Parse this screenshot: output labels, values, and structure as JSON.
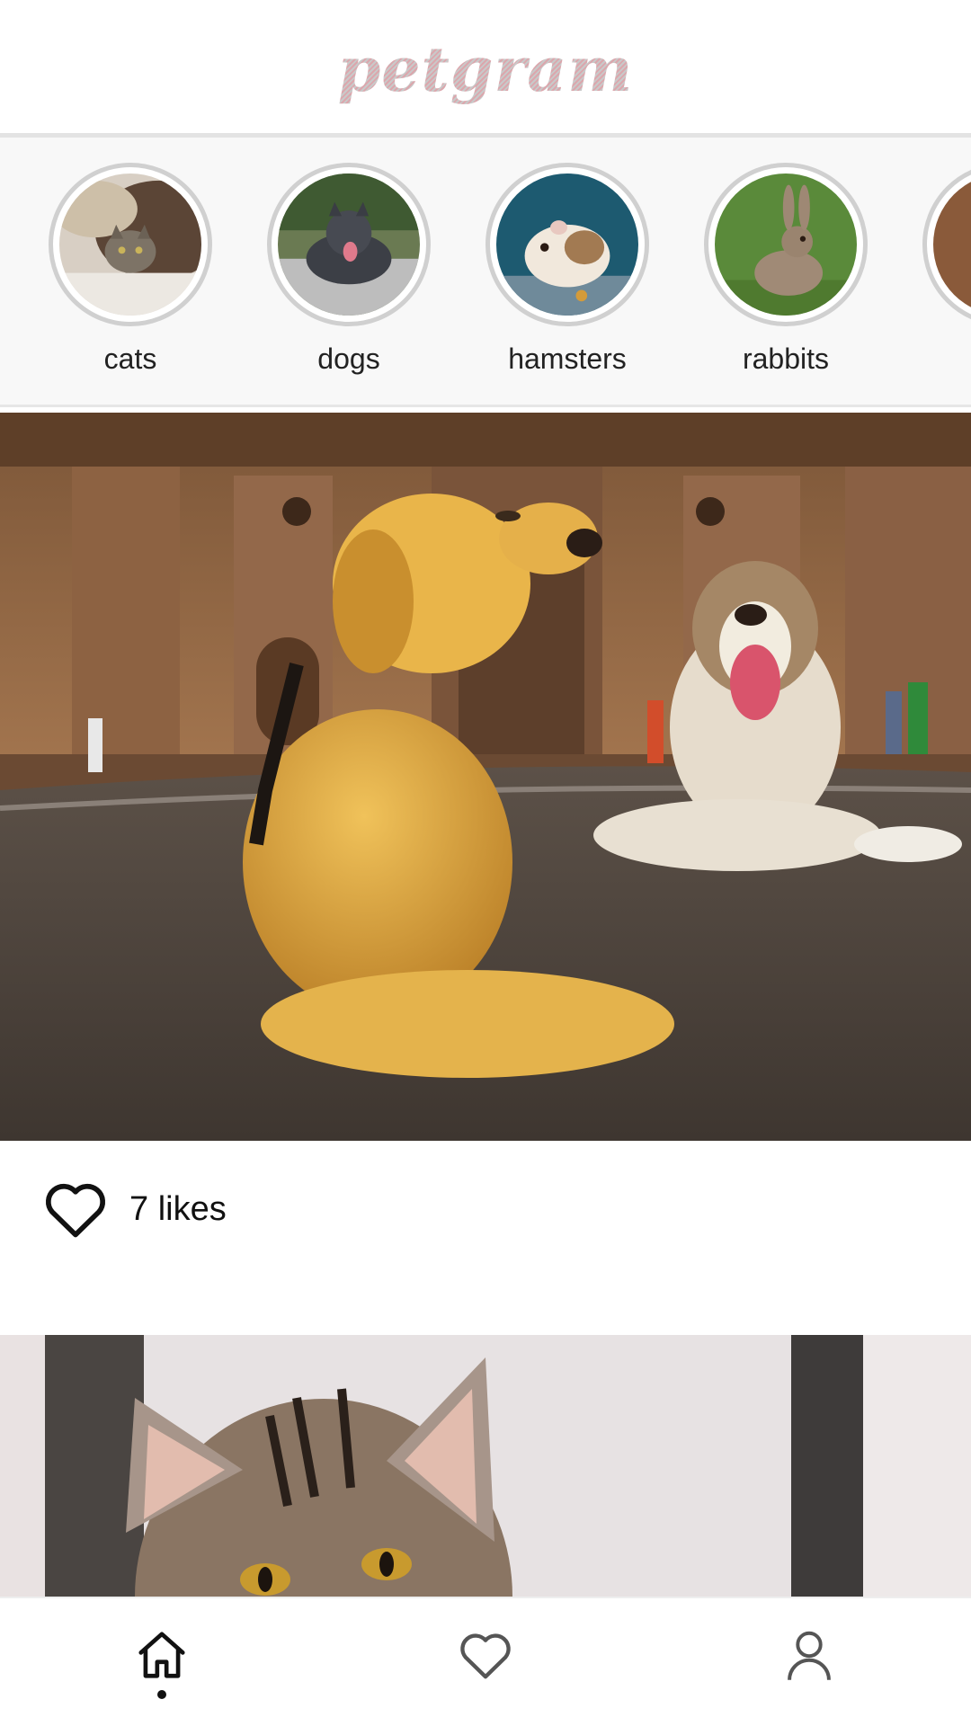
{
  "header": {
    "logo_text": "petgram",
    "logo_colors": [
      "#dba7ad",
      "#c9c9c9"
    ]
  },
  "categories": [
    {
      "label": "cats",
      "icon": "cat-photo"
    },
    {
      "label": "dogs",
      "icon": "dog-photo"
    },
    {
      "label": "hamsters",
      "icon": "hamster-photo"
    },
    {
      "label": "rabbits",
      "icon": "rabbit-photo"
    },
    {
      "label": "",
      "icon": "bird-photo"
    }
  ],
  "feed": {
    "posts": [
      {
        "photo": "two-dogs-photo",
        "likes_text": "7 likes",
        "liked": false
      },
      {
        "photo": "cat-photo"
      }
    ]
  },
  "bottom_nav": {
    "items": [
      {
        "icon": "home-icon",
        "active": true
      },
      {
        "icon": "heart-icon",
        "active": false
      },
      {
        "icon": "user-icon",
        "active": false
      }
    ]
  },
  "colors": {
    "accent": "#111111",
    "inactive_icon": "#555555",
    "category_ring": "#d0d0d0",
    "category_bg": "#f8f8f8"
  }
}
